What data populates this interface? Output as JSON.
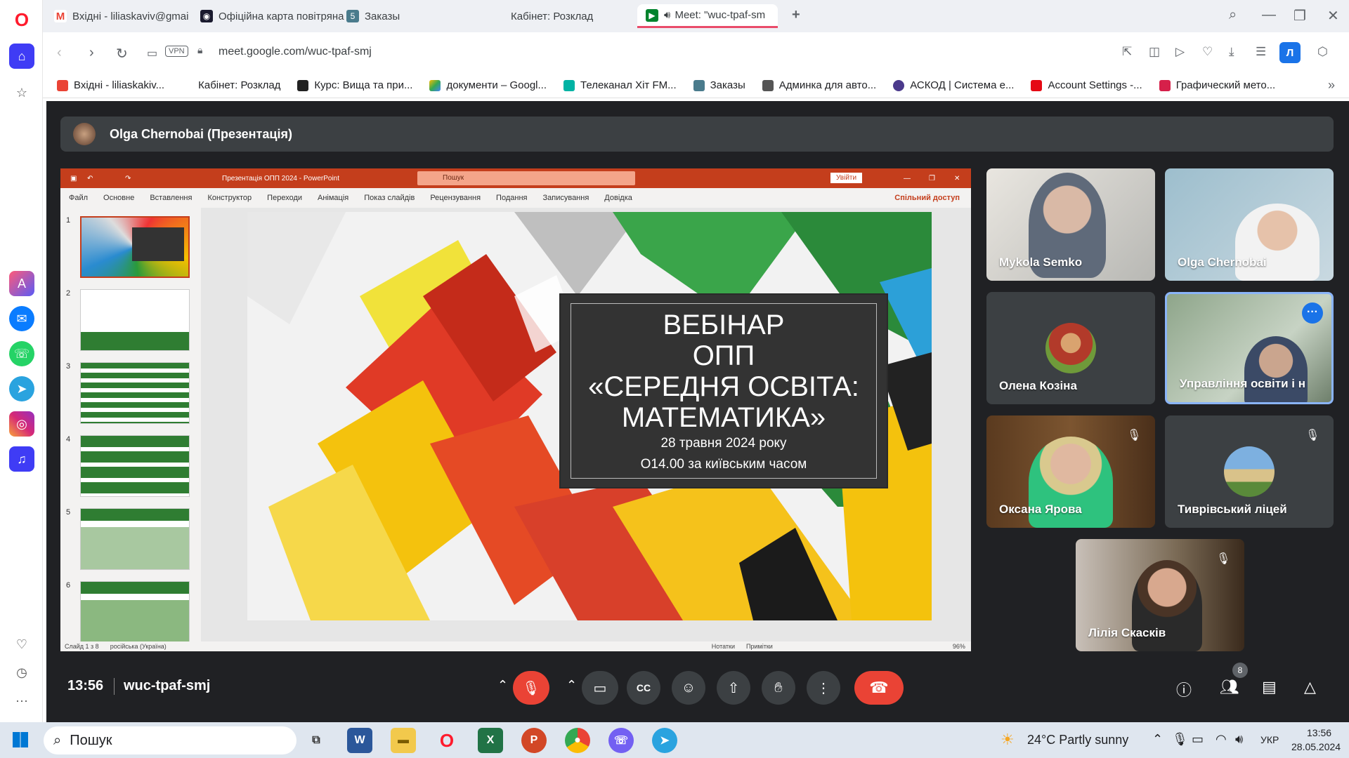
{
  "browser": {
    "tabs": [
      {
        "title": "Вхідні - liliaskaviv@gmai",
        "icon": "gmail-icon",
        "color": "#ea4335"
      },
      {
        "title": "Офіційна карта повітряна",
        "icon": "map-icon",
        "color": "#1a1a2e"
      },
      {
        "title": "Заказы",
        "icon": "5-icon",
        "color": "#4a7b8c"
      },
      {
        "title": "Кабінет: Розклад",
        "icon": "page-icon",
        "color": "#9aa0a6"
      },
      {
        "title": "Meet: \"wuc-tpaf-sm",
        "icon": "meet-icon",
        "color": "#00832d"
      }
    ],
    "url": "meet.google.com/wuc-tpaf-smj",
    "vpn_label": "VPN",
    "profile_letter": "Л",
    "bookmarks": [
      {
        "label": "Вхідні - liliaskakiv...",
        "color": "#ea4335"
      },
      {
        "label": "Кабінет: Розклад",
        "color": "#ffffff"
      },
      {
        "label": "Курс: Вища та при...",
        "color": "#222222"
      },
      {
        "label": "документи – Googl...",
        "color": "#fbbc04"
      },
      {
        "label": "Телеканал Хіт FM...",
        "color": "#00b3a4"
      },
      {
        "label": "Заказы",
        "color": "#4a7b8c"
      },
      {
        "label": "Админка для авто...",
        "color": "#555555"
      },
      {
        "label": "АСКОД | Система е...",
        "color": "#4b3a8c"
      },
      {
        "label": "Account Settings -...",
        "color": "#e50914"
      },
      {
        "label": "Графический мето...",
        "color": "#d6204a"
      }
    ]
  },
  "meet": {
    "presenter_label": "Olga Chernobai (Презентація)",
    "time": "13:56",
    "meeting_code": "wuc-tpaf-smj",
    "people_count": "8",
    "participants": [
      {
        "name": "Mykola Semko",
        "muted": false
      },
      {
        "name": "Olga Chernobai",
        "muted": false
      },
      {
        "name": "Олена Козіна",
        "muted": false
      },
      {
        "name": "Управління освіти і н",
        "muted": false
      },
      {
        "name": "Оксана Ярова",
        "muted": true
      },
      {
        "name": "Тиврівський ліцей",
        "muted": true
      },
      {
        "name": "Лілія Скасків",
        "muted": true
      }
    ]
  },
  "powerpoint": {
    "title": "Презентація ОПП 2024  -  PowerPoint",
    "search_placeholder": "Пошук",
    "signin": "Увійти",
    "share": "Спільний доступ",
    "tabs": [
      "Файл",
      "Основне",
      "Вставлення",
      "Конструктор",
      "Переходи",
      "Анімація",
      "Показ слайдів",
      "Рецензування",
      "Подання",
      "Записування",
      "Довідка"
    ],
    "slide_numbers": [
      "1",
      "2",
      "3",
      "4",
      "5",
      "6"
    ],
    "status_slide": "Слайд 1 з 8",
    "status_lang": "російська (Україна)",
    "status_notes": "Нотатки",
    "status_comments": "Примітки",
    "zoom": "96%",
    "slide": {
      "line1": "ВЕБІНАР",
      "line2": "ОПП",
      "line3": "«СЕРЕДНЯ ОСВІТА:",
      "line4": "МАТЕМАТИКА»",
      "date": "28 травня 2024 року",
      "time": "О14.00 за київським часом"
    }
  },
  "taskbar": {
    "search": "Пошук",
    "weather": "24°C  Partly sunny",
    "lang": "УКР",
    "time": "13:56",
    "date": "28.05.2024"
  }
}
